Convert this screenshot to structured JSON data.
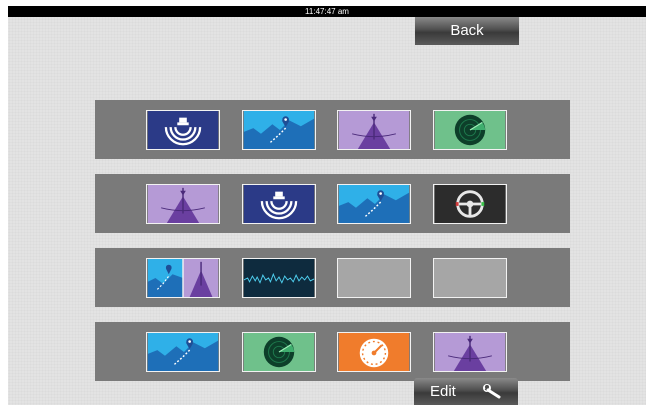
{
  "status_bar": {
    "time": "11:47:47 am"
  },
  "back_button": {
    "label": "Back",
    "icon": "back"
  },
  "edit_button": {
    "label": "Edit",
    "icon": "wrench-icon"
  },
  "colors": {
    "sonar": "#2b3a87",
    "chart_water": "#2fb0e8",
    "chart_land": "#1e6fb8",
    "structure": "#b59ad6",
    "radar": "#6fc18b",
    "autopilot": "#2c2c2c",
    "instruments": "#f07c2c",
    "empty": "#a6a6a6",
    "row_bg": "#7a7a7a"
  },
  "favorites": [
    {
      "row": 1,
      "tiles": [
        "sonar",
        "chart",
        "structure-scan",
        "radar"
      ]
    },
    {
      "row": 2,
      "tiles": [
        "structure-scan",
        "sonar",
        "chart",
        "autopilot"
      ]
    },
    {
      "row": 3,
      "tiles": [
        "chart + structure-scan",
        "echo-graph",
        "empty",
        "empty"
      ]
    },
    {
      "row": 4,
      "tiles": [
        "chart",
        "radar",
        "instruments",
        "structure-scan"
      ]
    }
  ]
}
